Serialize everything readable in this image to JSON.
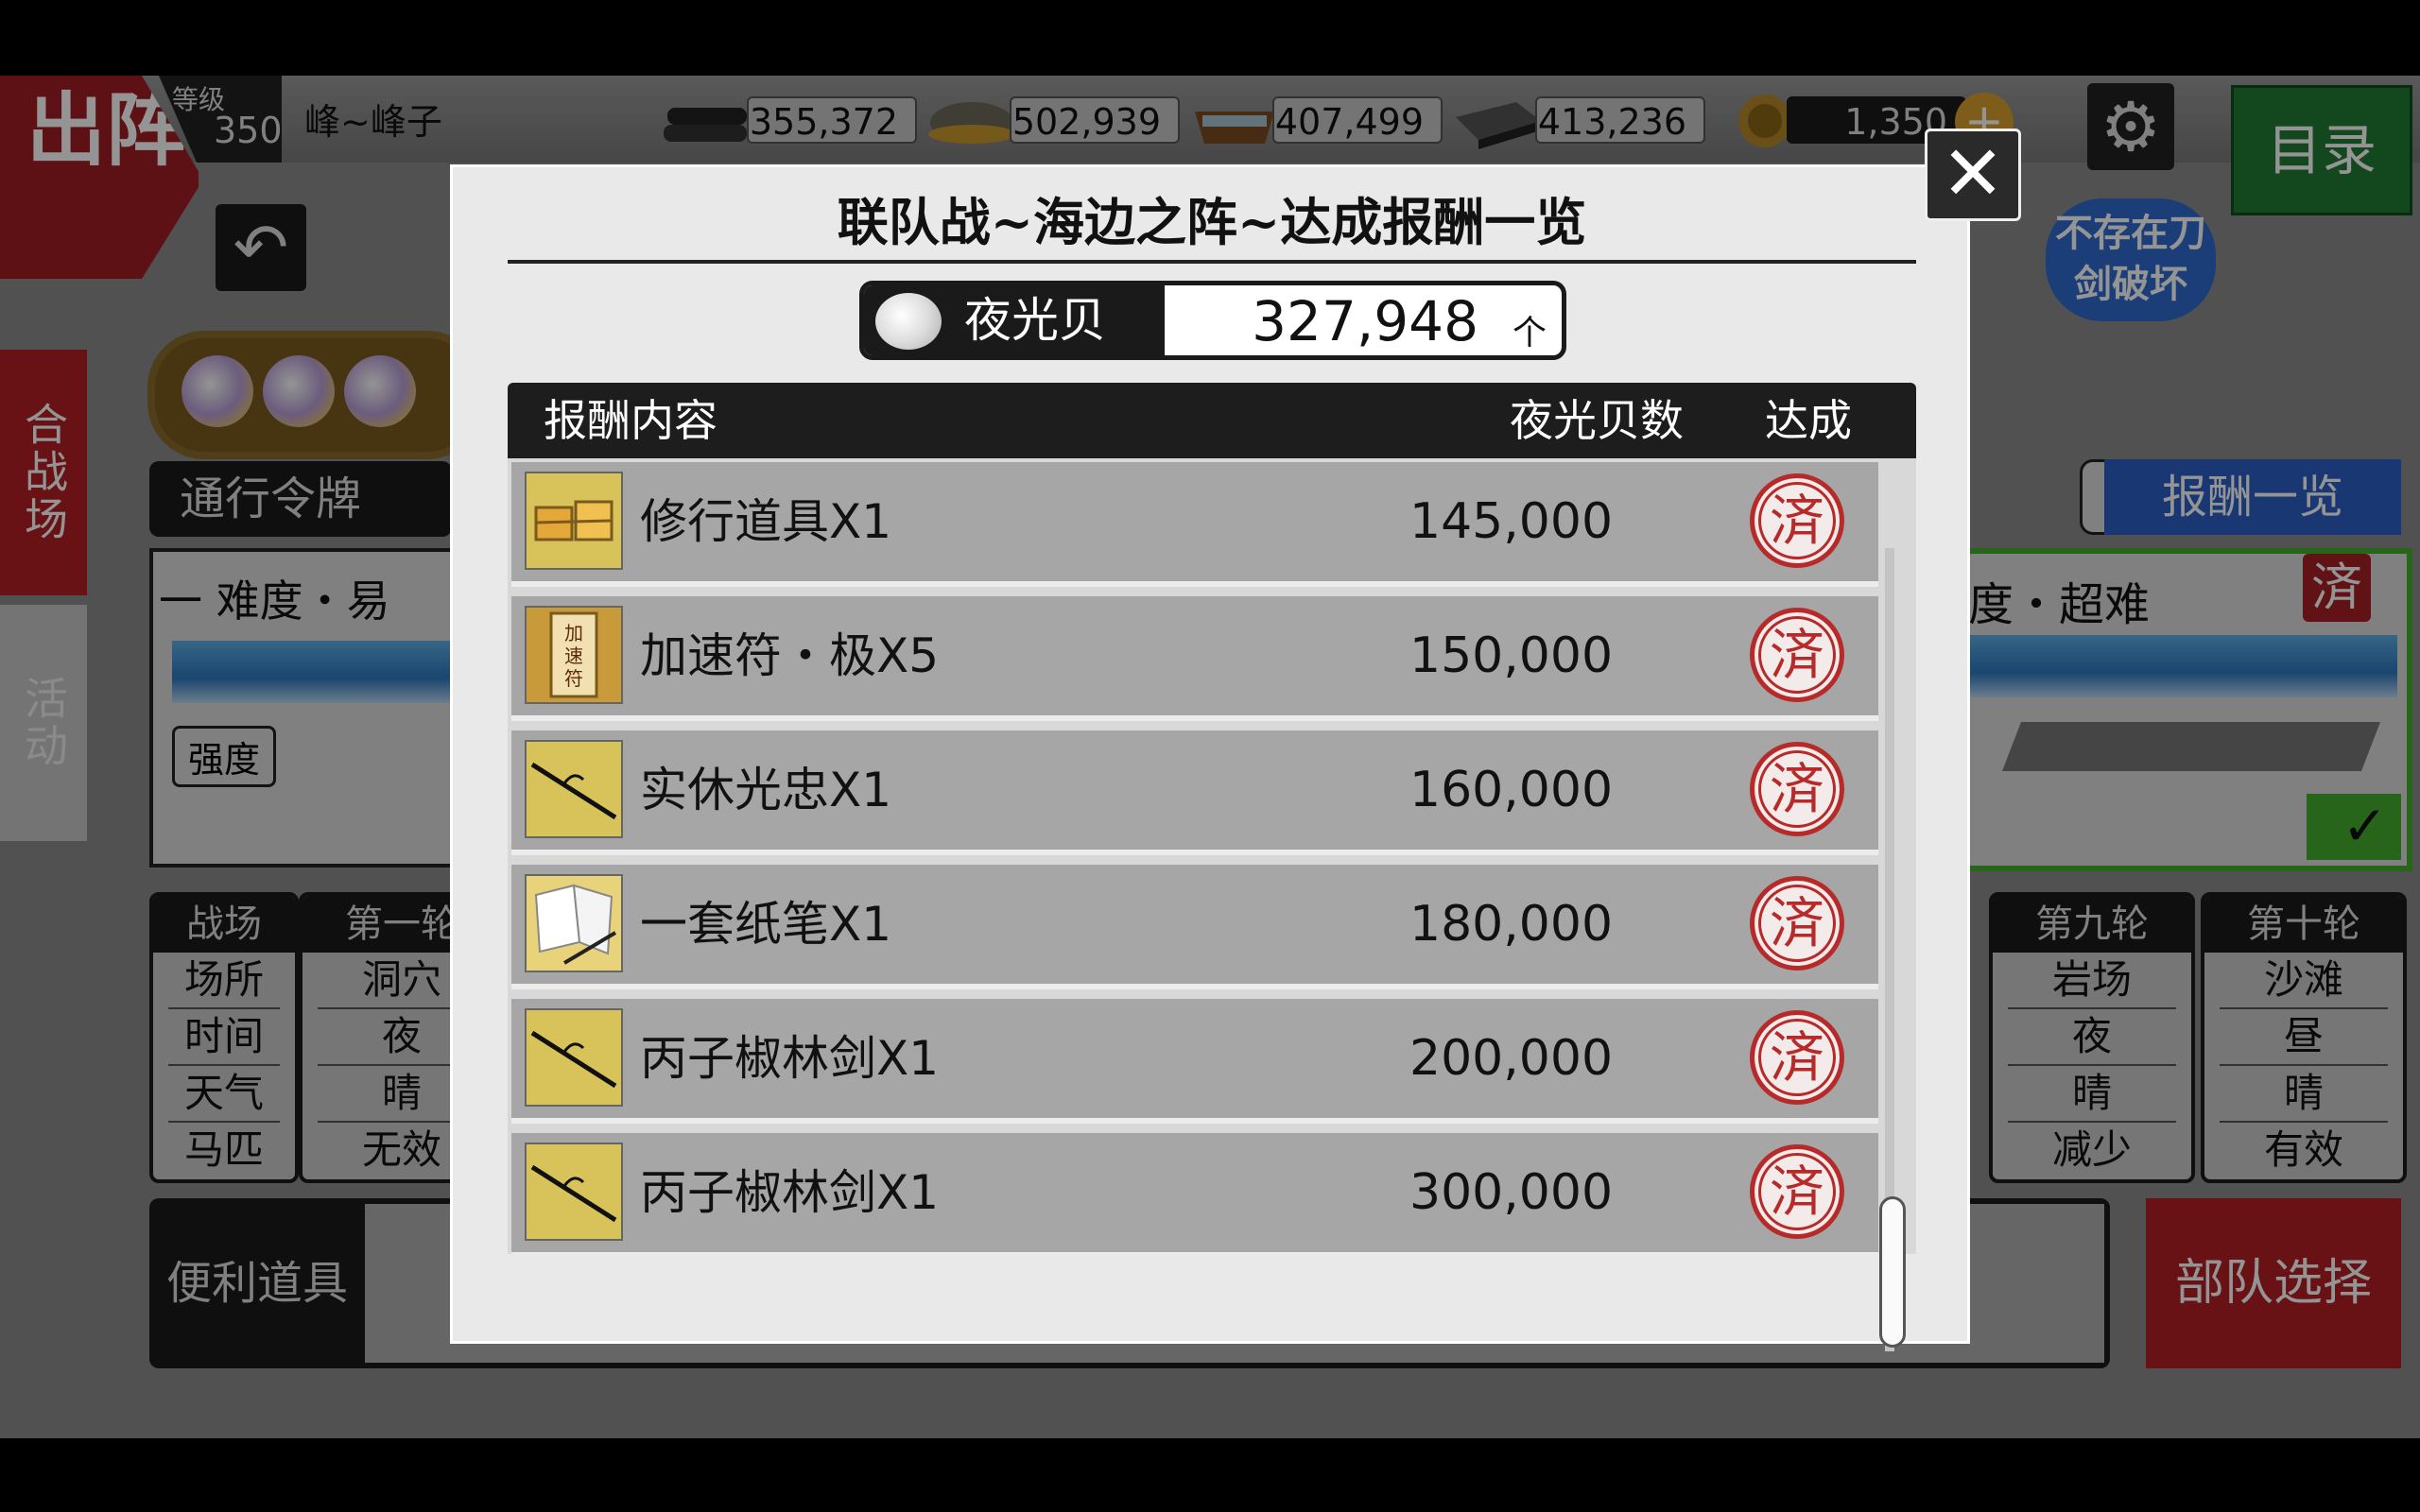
{
  "topbar": {
    "section_title": "出阵",
    "level_label": "等级",
    "level_value": "350",
    "player_name": "峰~峰子",
    "resources": [
      {
        "icon": "charcoal-icon",
        "value": "355,372"
      },
      {
        "icon": "whetstone-icon",
        "value": "502,939"
      },
      {
        "icon": "coolant-icon",
        "value": "407,499"
      },
      {
        "icon": "steel-icon",
        "value": "413,236"
      }
    ],
    "coins": "1,350",
    "menu_label": "目录"
  },
  "side_tabs": [
    "合战场",
    "活动"
  ],
  "background": {
    "pass_label": "通行令牌",
    "left_difficulty": "一 难度・易",
    "strength_label": "强度",
    "right_difficulty": "度・超难",
    "right_difficulty_stamp": "済",
    "count_unit": "个",
    "reward_list_button": "报酬一览",
    "no_break_badge": "不存在刀剑破坏",
    "rounds": [
      {
        "header": "战场",
        "cells": [
          "场所",
          "时间",
          "天气",
          "马匹"
        ]
      },
      {
        "header": "第一轮",
        "cells": [
          "洞穴",
          "夜",
          "晴",
          "无效"
        ]
      },
      {
        "header": "第九轮",
        "cells": [
          "岩场",
          "夜",
          "晴",
          "减少"
        ]
      },
      {
        "header": "第十轮",
        "cells": [
          "沙滩",
          "昼",
          "晴",
          "有效"
        ]
      }
    ],
    "convenience_items_label": "便利道具",
    "squad_select_button": "部队选择"
  },
  "modal": {
    "title": "联队战~海边之阵~达成报酬一览",
    "currency_name": "夜光贝",
    "currency_count": "327,948",
    "currency_unit": "个",
    "columns": {
      "content": "报酬内容",
      "cost": "夜光贝数",
      "achieved": "达成"
    },
    "stamp_text": "済",
    "rewards": [
      {
        "icon": "training-tools-icon",
        "name": "修行道具X1",
        "cost": "145,000"
      },
      {
        "icon": "speedup-talisman-icon",
        "name": "加速符・极X5",
        "cost": "150,000"
      },
      {
        "icon": "sword-icon",
        "name": "实休光忠X1",
        "cost": "160,000"
      },
      {
        "icon": "paper-brush-icon",
        "name": "一套纸笔X1",
        "cost": "180,000"
      },
      {
        "icon": "sword-icon",
        "name": "丙子椒林剑X1",
        "cost": "200,000"
      },
      {
        "icon": "sword-icon",
        "name": "丙子椒林剑X1",
        "cost": "300,000"
      }
    ]
  },
  "colors": {
    "accent_red": "#b51f26",
    "menu_green": "#227a33",
    "reward_blue": "#2c5fc4",
    "stamp_red": "#b72a2a"
  }
}
